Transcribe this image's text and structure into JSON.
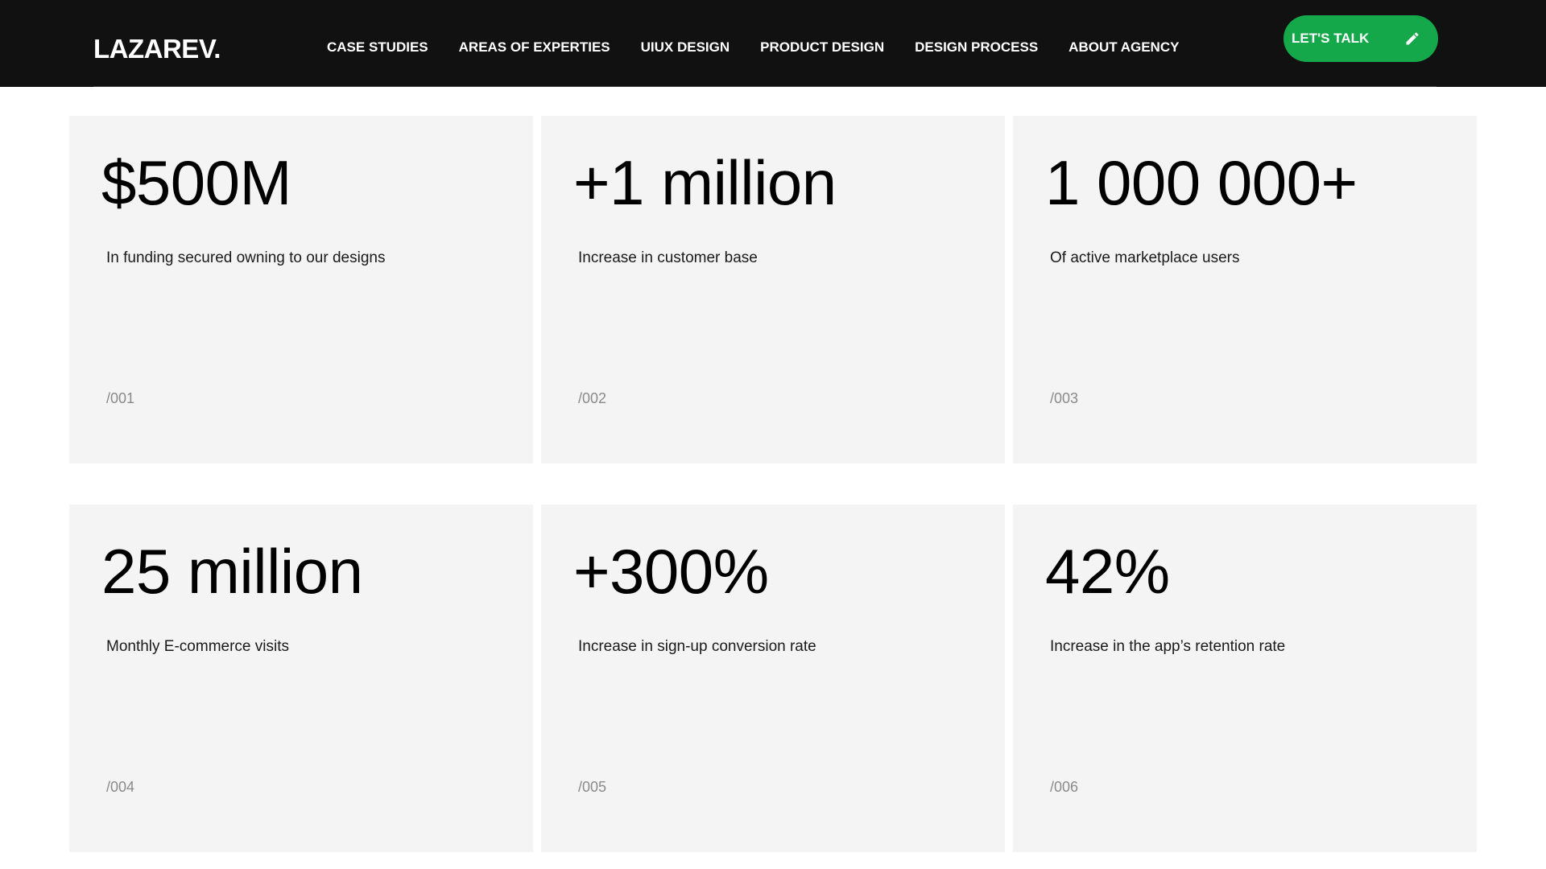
{
  "header": {
    "logo": "LAZAREV.",
    "nav": [
      {
        "label": "CASE STUDIES",
        "id": "case-studies"
      },
      {
        "label": "AREAS OF EXPERTIES",
        "id": "areas-of-experties"
      },
      {
        "label": "UIUX DESIGN",
        "id": "uiux-design"
      },
      {
        "label": "PRODUCT DESIGN",
        "id": "product-design"
      },
      {
        "label": "DESIGN PROCESS",
        "id": "design-process"
      },
      {
        "label": "ABOUT AGENCY",
        "id": "about-agency"
      }
    ],
    "cta": {
      "label": "LET'S TALK",
      "icon": "pencil-icon"
    }
  },
  "stats": [
    {
      "value": "$500M",
      "description": "In funding secured owning to our designs",
      "number": "/001"
    },
    {
      "value": "+1 million",
      "description": "Increase in customer base",
      "number": "/002"
    },
    {
      "value": "1 000 000+",
      "description": "Of active marketplace users",
      "number": "/003"
    },
    {
      "value": "25 million",
      "description": "Monthly E-commerce visits",
      "number": "/004"
    },
    {
      "value": "+300%",
      "description": "Increase in sign-up conversion rate",
      "number": "/005"
    },
    {
      "value": "42%",
      "description": "Increase in the app’s retention rate",
      "number": "/006"
    }
  ],
  "colors": {
    "header_bg": "#111111",
    "accent": "#14a84a",
    "card_bg": "#f4f4f4"
  }
}
